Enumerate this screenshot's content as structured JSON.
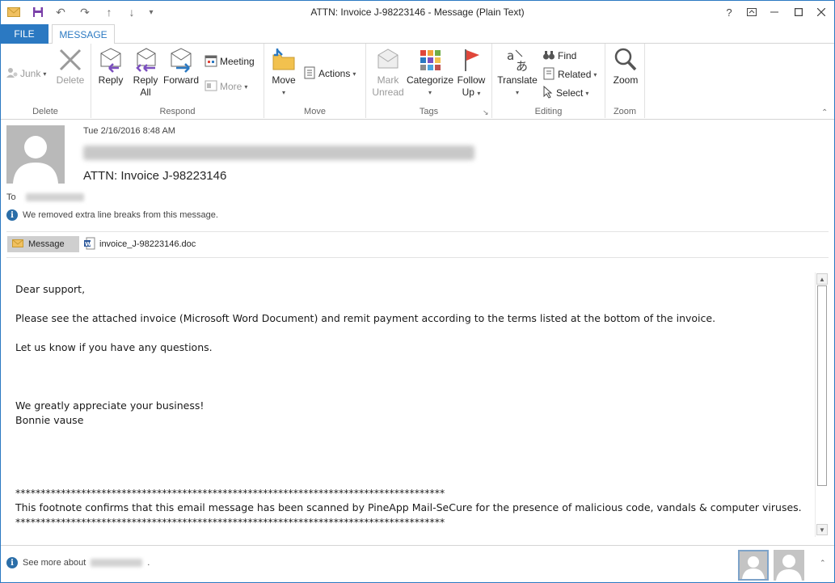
{
  "window": {
    "title": "ATTN: Invoice J-98223146 - Message (Plain Text)",
    "help_glyph": "?"
  },
  "tabs": {
    "file": "FILE",
    "message": "MESSAGE"
  },
  "ribbon": {
    "delete_group": {
      "label": "Delete",
      "junk": "Junk",
      "delete": "Delete"
    },
    "respond_group": {
      "label": "Respond",
      "reply": "Reply",
      "reply_all_line1": "Reply",
      "reply_all_line2": "All",
      "forward": "Forward",
      "meeting": "Meeting",
      "more": "More"
    },
    "move_group": {
      "label": "Move",
      "move": "Move",
      "actions": "Actions"
    },
    "tags_group": {
      "label": "Tags",
      "mark_unread_line1": "Mark",
      "mark_unread_line2": "Unread",
      "categorize": "Categorize",
      "follow_up_line1": "Follow",
      "follow_up_line2": "Up"
    },
    "editing_group": {
      "label": "Editing",
      "translate": "Translate",
      "find": "Find",
      "related": "Related",
      "select": "Select"
    },
    "zoom_group": {
      "label": "Zoom",
      "zoom": "Zoom"
    }
  },
  "message": {
    "date": "Tue 2/16/2016 8:48 AM",
    "subject": "ATTN: Invoice J-98223146",
    "to_label": "To",
    "info_notice": "We removed extra line breaks from this message.",
    "message_button": "Message",
    "attachment_name": "invoice_J-98223146.doc",
    "body": "Dear support,\n\nPlease see the attached invoice (Microsoft Word Document) and remit payment according to the terms listed at the bottom of the invoice.\n\nLet us know if you have any questions.\n\n\n\nWe greatly appreciate your business!\nBonnie vause\n\n\n\n\n*************************************************************************************\nThis footnote confirms that this email message has been scanned by PineApp Mail-SeCure for the presence of malicious code, vandals & computer viruses.\n*************************************************************************************"
  },
  "footer": {
    "see_more_prefix": "See more about",
    "see_more_suffix": "."
  },
  "colors": {
    "accent": "#2b79c2",
    "reply_arrow": "#7b4fbf",
    "forward_arrow": "#2b79c2",
    "follow_flag": "#e0463a"
  }
}
